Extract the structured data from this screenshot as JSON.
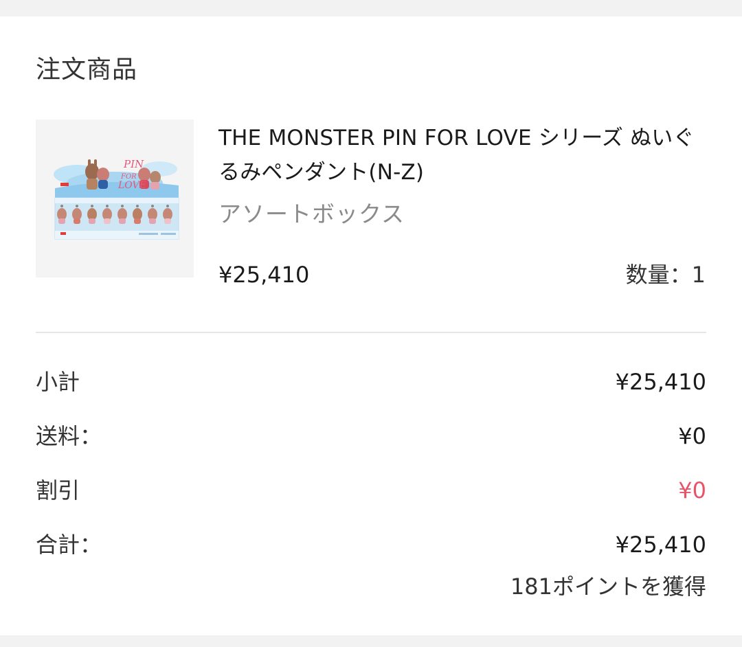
{
  "order": {
    "section_title": "注文商品",
    "product": {
      "image_label": "PIN FOR LOVE",
      "name": "THE MONSTER PIN FOR LOVE シリーズ ぬいぐるみペンダント(N-Z)",
      "variant": "アソートボックス",
      "price": "¥25,410",
      "quantity": "数量：1"
    },
    "summary": {
      "subtotal_label": "小計",
      "subtotal_value": "¥25,410",
      "shipping_label": "送料：",
      "shipping_value": "¥0",
      "discount_label": "割引",
      "discount_value": "¥0",
      "total_label": "合計：",
      "total_value": "¥25,410",
      "points": "181ポイントを獲得"
    }
  },
  "colors": {
    "background": "#f2f2f2",
    "card": "#ffffff",
    "discount": "#e8536a",
    "muted_text": "#8a8a8a",
    "divider": "#e6e6e6"
  }
}
